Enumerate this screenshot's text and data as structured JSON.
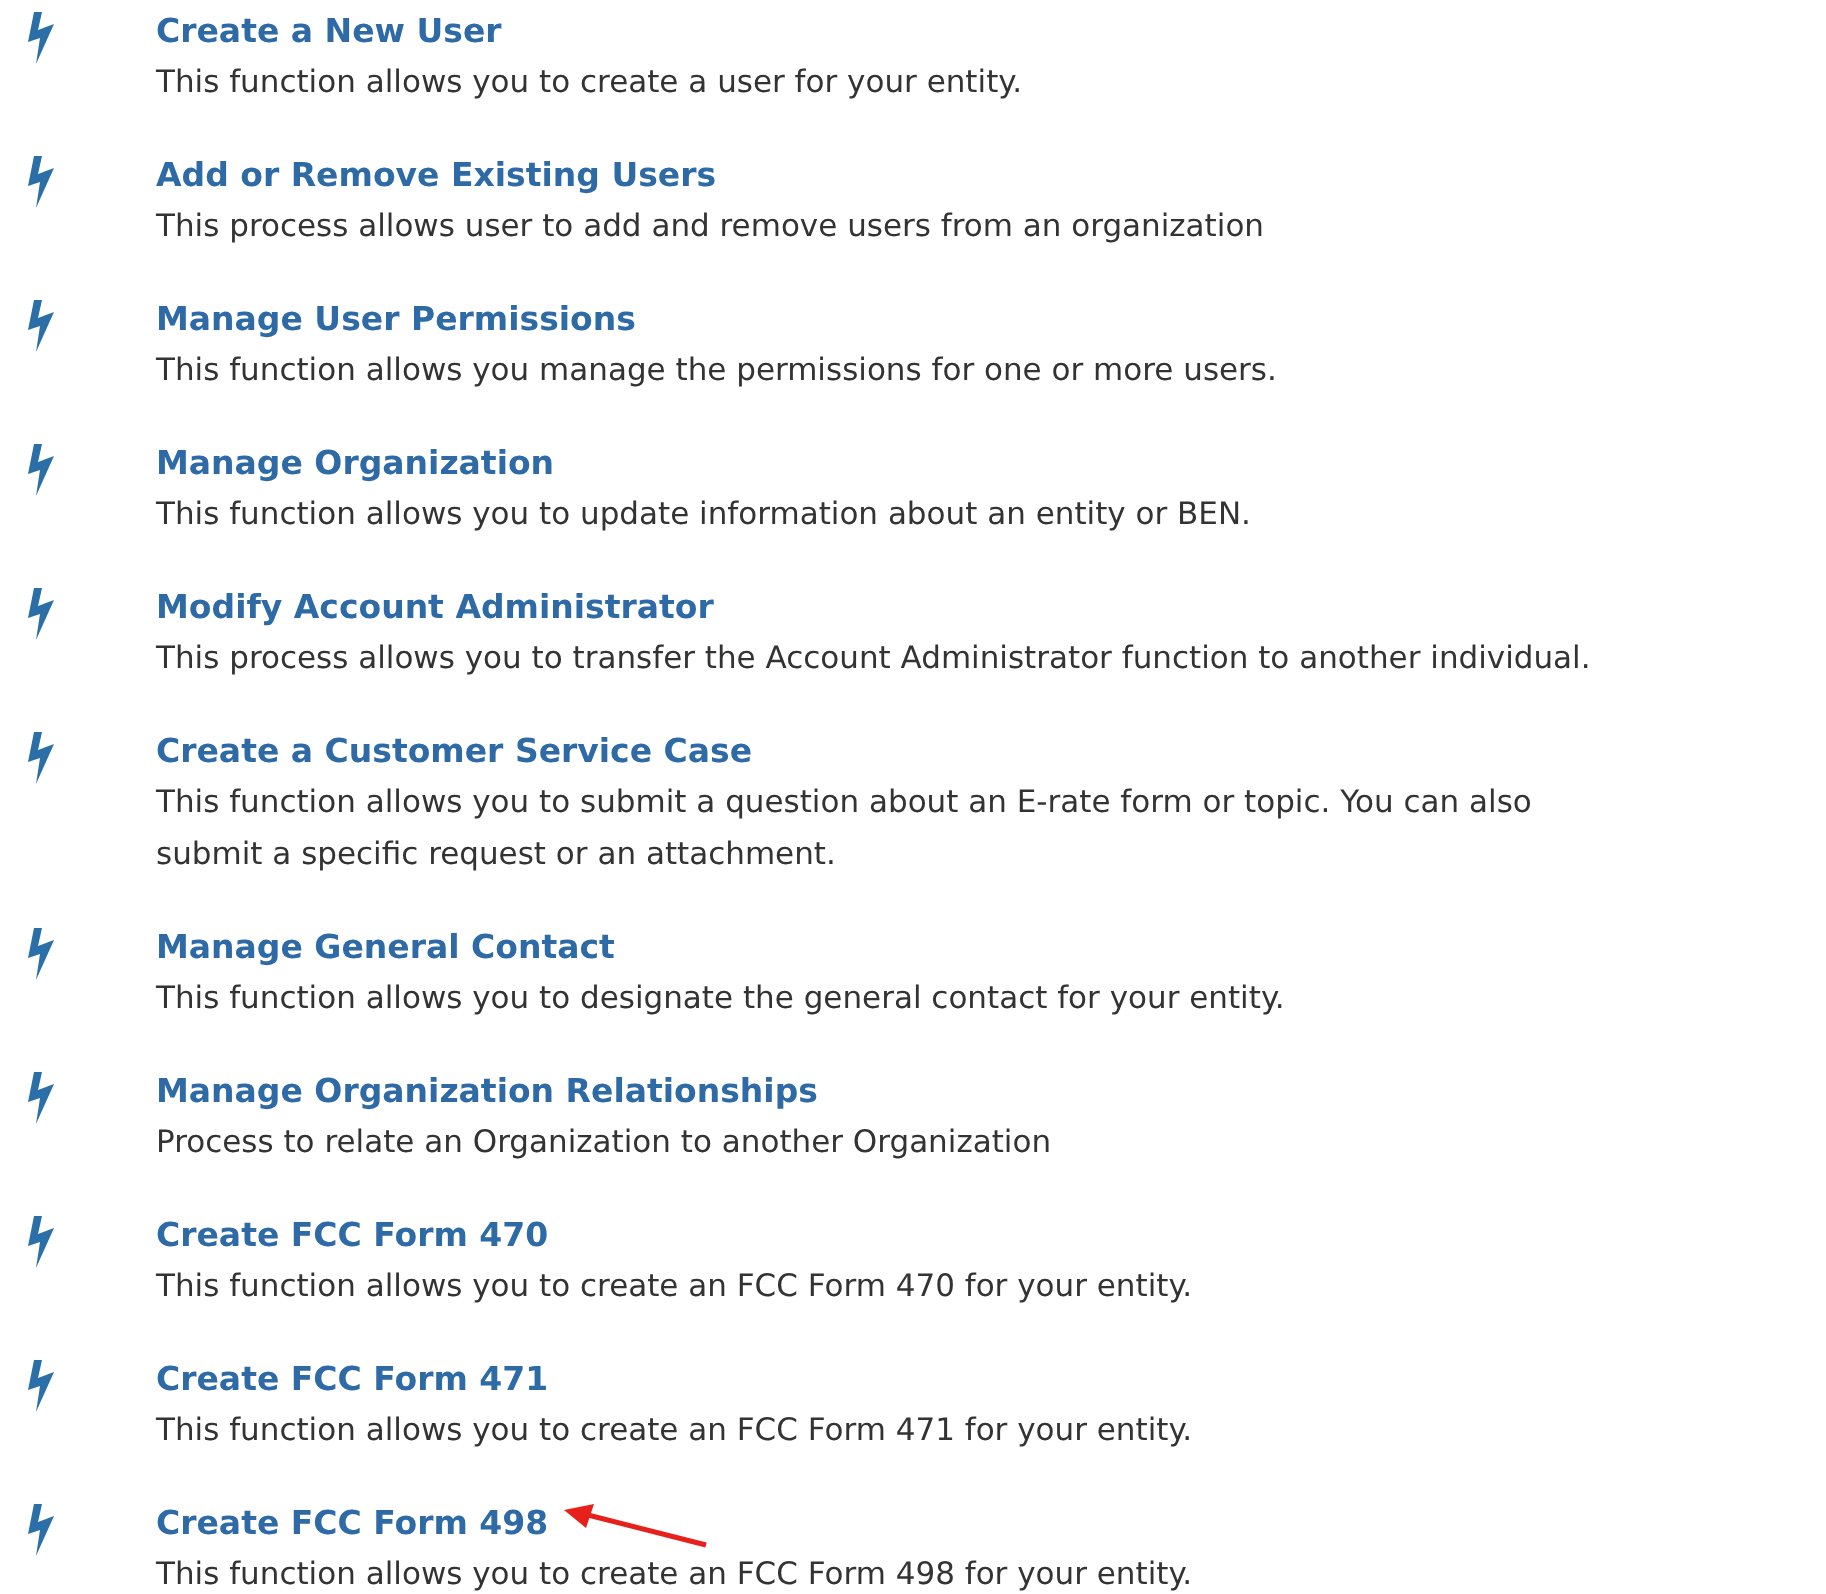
{
  "functions": [
    {
      "title": "Create a New User",
      "description": "This function allows you to create a user for your entity."
    },
    {
      "title": "Add or Remove Existing Users",
      "description": "This process allows user to add and remove users from an organization"
    },
    {
      "title": "Manage User Permissions",
      "description": "This function allows you manage the permissions for one or more users."
    },
    {
      "title": "Manage Organization",
      "description": "This function allows you to update information about an entity or BEN."
    },
    {
      "title": "Modify Account Administrator",
      "description": "This process allows you to transfer the Account Administrator function to another individual."
    },
    {
      "title": "Create a Customer Service Case",
      "description": "This function allows you to submit a question about an E-rate form or topic. You can also submit a specific request or an attachment."
    },
    {
      "title": "Manage General Contact",
      "description": "This function allows you to designate the general contact for your entity."
    },
    {
      "title": "Manage Organization Relationships",
      "description": "Process to relate an Organization to another Organization"
    },
    {
      "title": "Create FCC Form 470",
      "description": "This function allows you to create an FCC Form 470 for your entity."
    },
    {
      "title": "Create FCC Form 471",
      "description": "This function allows you to create an FCC Form 471 for your entity."
    },
    {
      "title": "Create FCC Form 498",
      "description": "This function allows you to create an FCC Form 498 for your entity."
    }
  ]
}
